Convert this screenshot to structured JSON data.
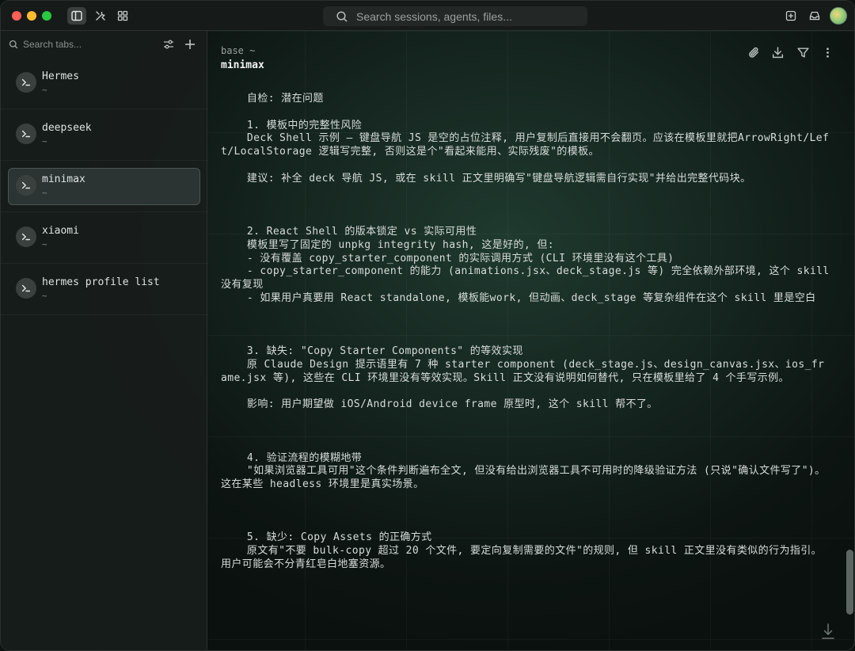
{
  "titlebar": {
    "search_placeholder": "Search sessions, agents, files...",
    "icons": [
      "sidebar-toggle-icon",
      "tools-icon",
      "grid-icon",
      "new-window-icon",
      "inbox-icon",
      "avatar"
    ]
  },
  "sidebar": {
    "search_placeholder": "Search tabs...",
    "tabs": [
      {
        "title": "Hermes",
        "subtitle": "~"
      },
      {
        "title": "deepseek",
        "subtitle": "~"
      },
      {
        "title": "minimax",
        "subtitle": "~",
        "selected": true
      },
      {
        "title": "xiaomi",
        "subtitle": "~"
      },
      {
        "title": "hermes profile list",
        "subtitle": "~"
      }
    ]
  },
  "main": {
    "breadcrumb": "base ~",
    "title": "minimax",
    "message": "    自检: 潜在问题\n\n    1. 模板中的完整性风险\n    Deck Shell 示例 — 键盘导航 JS 是空的占位注释, 用户复制后直接用不会翻页。应该在模板里就把ArrowRight/Left/LocalStorage 逻辑写完整, 否则这是个\"看起来能用、实际残废\"的模板。\n\n    建议: 补全 deck 导航 JS, 或在 skill 正文里明确写\"键盘导航逻辑需自行实现\"并给出完整代码块。\n\n\n\n    2. React Shell 的版本锁定 vs 实际可用性\n    模板里写了固定的 unpkg integrity hash, 这是好的, 但:\n    - 没有覆盖 copy_starter_component 的实际调用方式 (CLI 环境里没有这个工具)\n    - copy_starter_component 的能力 (animations.jsx、deck_stage.js 等) 完全依赖外部环境, 这个 skill 没有复现\n    - 如果用户真要用 React standalone, 模板能work, 但动画、deck_stage 等复杂组件在这个 skill 里是空白\n\n\n\n    3. 缺失: \"Copy Starter Components\" 的等效实现\n    原 Claude Design 提示语里有 7 种 starter component (deck_stage.js、design_canvas.jsx、ios_frame.jsx 等), 这些在 CLI 环境里没有等效实现。Skill 正文没有说明如何替代, 只在模板里给了 4 个手写示例。\n\n    影响: 用户期望做 iOS/Android device frame 原型时, 这个 skill 帮不了。\n\n\n\n    4. 验证流程的模糊地带\n    \"如果浏览器工具可用\"这个条件判断遍布全文, 但没有给出浏览器工具不可用时的降级验证方法 (只说\"确认文件写了\")。这在某些 headless 环境里是真实场景。\n\n\n\n    5. 缺少: Copy Assets 的正确方式\n    原文有\"不要 bulk-copy 超过 20 个文件, 要定向复制需要的文件\"的规则, 但 skill 正文里没有类似的行为指引。用户可能会不分青红皂白地塞资源。"
  },
  "colors": {
    "accent_green": "#28c840",
    "accent_yellow": "#febc2e",
    "accent_red": "#fe5f57",
    "background": "#15251f"
  }
}
